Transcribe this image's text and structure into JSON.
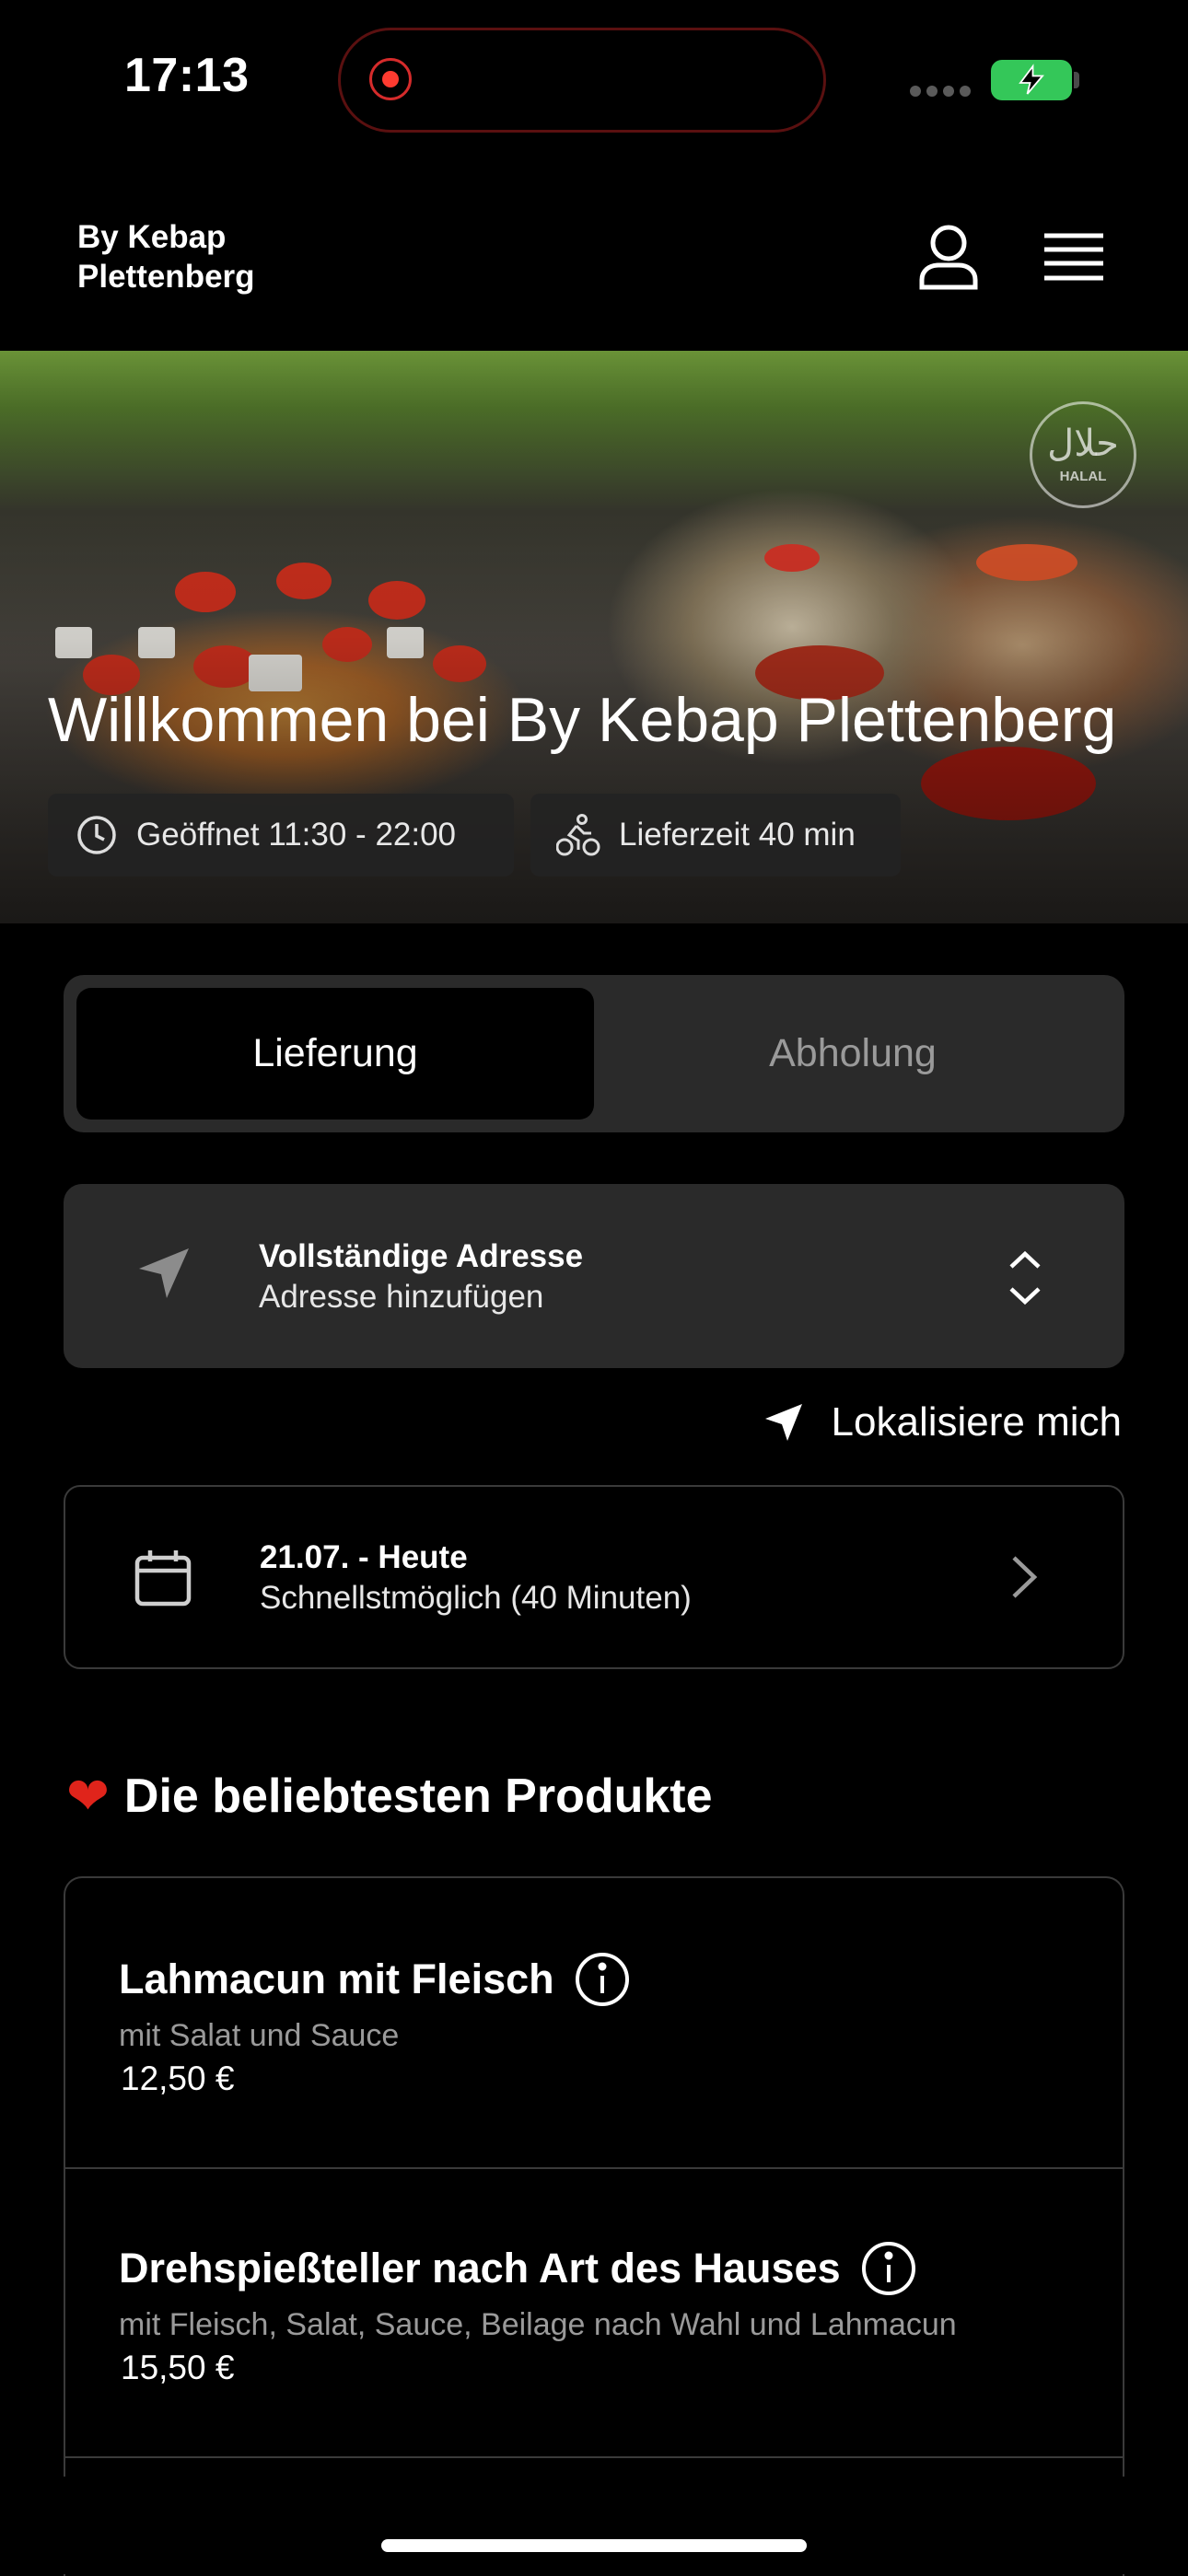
{
  "status_bar": {
    "time": "17:13"
  },
  "header": {
    "brand_line1": "By Kebap",
    "brand_line2": "Plettenberg"
  },
  "hero": {
    "title": "Willkommen bei By Kebap Plettenberg",
    "badge": "HALAL",
    "hours": "Geöffnet 11:30 - 22:00",
    "delivery_time": "Lieferzeit 40 min"
  },
  "order_mode": {
    "tabs": [
      {
        "label": "Lieferung",
        "selected": true
      },
      {
        "label": "Abholung",
        "selected": false
      }
    ]
  },
  "address": {
    "title": "Vollständige Adresse",
    "subtitle": "Adresse hinzufügen",
    "locate_label": "Lokalisiere mich"
  },
  "schedule": {
    "title": "21.07. - Heute",
    "subtitle": "Schnellstmöglich (40 Minuten)"
  },
  "popular": {
    "heading": "Die beliebtesten Produkte",
    "products": [
      {
        "name": "Lahmacun mit Fleisch",
        "description": "mit Salat und Sauce",
        "price": "12,50 €"
      },
      {
        "name": "Drehspießteller nach Art des Hauses",
        "description": "mit Fleisch, Salat, Sauce, Beilage nach Wahl und Lahmacun",
        "price": "15,50 €"
      }
    ]
  },
  "colors": {
    "accent": "#ff3b30",
    "battery": "#34c759",
    "card": "#2a2a2a",
    "muted": "#9a9a9a"
  }
}
